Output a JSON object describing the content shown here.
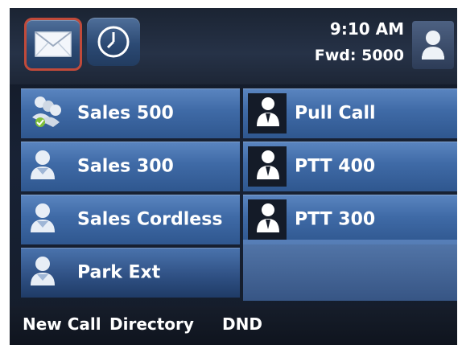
{
  "header": {
    "time": "9:10 AM",
    "forward_status": "Fwd: 5000"
  },
  "icons": {
    "messages": "envelope-icon",
    "history": "clock-icon",
    "user": "user-icon",
    "line": "person-icon",
    "group": "group-icon"
  },
  "line_keys_left": [
    {
      "label": "Sales 500",
      "icon": "group-icon"
    },
    {
      "label": "Sales 300",
      "icon": "person-icon"
    },
    {
      "label": "Sales Cordless",
      "icon": "person-icon"
    },
    {
      "label": "Park Ext",
      "icon": "person-icon"
    }
  ],
  "line_keys_right": [
    {
      "label": "Pull Call",
      "icon": "contact-icon"
    },
    {
      "label": "PTT 400",
      "icon": "contact-icon"
    },
    {
      "label": "PTT 300",
      "icon": "contact-icon"
    }
  ],
  "softkeys": {
    "new_call": "New Call",
    "directory": "Directory",
    "dnd": "DND"
  },
  "colors": {
    "accent_blue": "#3f6aa6",
    "highlight_border": "#c14a3a",
    "text": "#ffffff"
  }
}
